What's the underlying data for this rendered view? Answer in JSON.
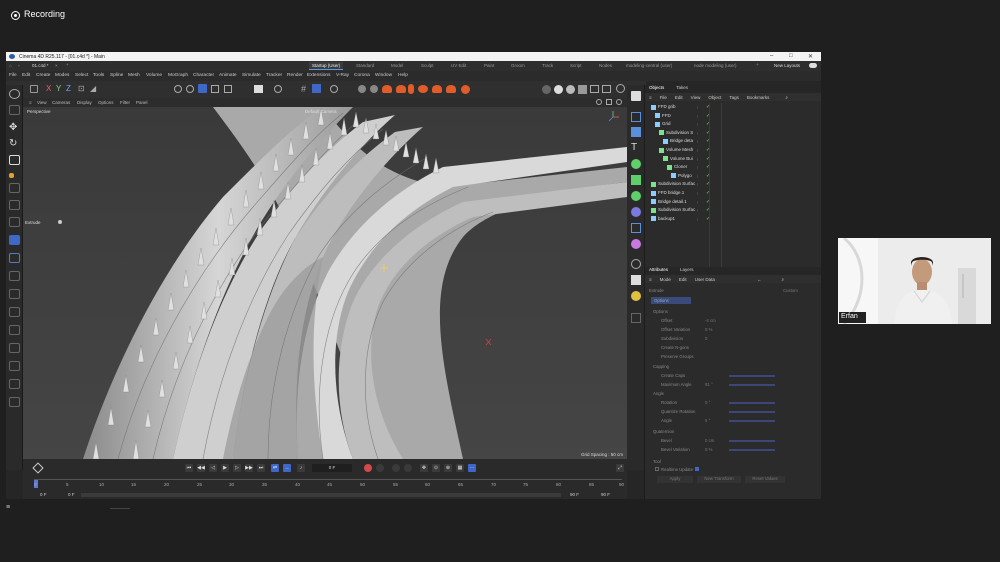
{
  "meeting": {
    "recording_label": "Recording",
    "participant_name": "Erfan"
  },
  "window": {
    "title": "Cinema 4D R25.117 - [01.c4d *] - Main",
    "minimize": "–",
    "maximize": "□",
    "close": "✕"
  },
  "tabs": {
    "file_tab": "01.c4d *",
    "layouts": [
      "Startup (User)",
      "Standard",
      "Model",
      "Sculpt",
      "UV Edit",
      "Paint",
      "Groom",
      "Track",
      "Script",
      "Nodes",
      "modeling-central (user)",
      "node modeling (user)"
    ],
    "new_layouts": "New Layouts"
  },
  "menu": [
    "File",
    "Edit",
    "Create",
    "Modes",
    "Select",
    "Tools",
    "Spline",
    "Mesh",
    "Volume",
    "MoGraph",
    "Character",
    "Animate",
    "Simulate",
    "Tracker",
    "Render",
    "Extensions",
    "V-Ray",
    "Corona",
    "Window",
    "Help"
  ],
  "viewport_menu": [
    "View",
    "Cameras",
    "Display",
    "Options",
    "Filter",
    "Panel"
  ],
  "viewport": {
    "view_name": "Perspective",
    "camera": "Default Camera",
    "grid_spacing": "Grid Spacing : 50 cm",
    "hud_tool": "Extrude"
  },
  "timeline": {
    "ticks": [
      "0",
      "5",
      "10",
      "15",
      "20",
      "25",
      "30",
      "35",
      "40",
      "45",
      "50",
      "55",
      "60",
      "65",
      "70",
      "75",
      "80",
      "85",
      "90"
    ],
    "start": "0 F",
    "preview_start": "0 F",
    "current": "0 F",
    "end": "90 F",
    "preview_end": "90 F"
  },
  "objects_panel": {
    "tabs": [
      "Objects",
      "Takes"
    ],
    "menu": [
      "File",
      "Edit",
      "View",
      "Object",
      "Tags",
      "Bookmarks"
    ],
    "items": [
      {
        "name": "FFD grib",
        "depth": 0,
        "color": "#8ecbff"
      },
      {
        "name": "FFD",
        "depth": 1,
        "color": "#8ecbff"
      },
      {
        "name": "Grid",
        "depth": 1,
        "color": "#8ecbff"
      },
      {
        "name": "Subdivision S",
        "depth": 2,
        "color": "#7fe08a"
      },
      {
        "name": "Bridge deta",
        "depth": 3,
        "color": "#8ecbff"
      },
      {
        "name": "Volume Mesh",
        "depth": 2,
        "color": "#7fe08a"
      },
      {
        "name": "Volume Bui",
        "depth": 3,
        "color": "#7fe08a"
      },
      {
        "name": "Cloner",
        "depth": 4,
        "color": "#7fe08a"
      },
      {
        "name": "Polygo",
        "depth": 5,
        "color": "#8ecbff"
      },
      {
        "name": "Subdivision Surfac",
        "depth": 0,
        "color": "#7fe08a"
      },
      {
        "name": "FFD bridge.1",
        "depth": 0,
        "color": "#8ecbff"
      },
      {
        "name": "Bridge detail.1",
        "depth": 0,
        "color": "#8ecbff"
      },
      {
        "name": "Subdivision Surfac",
        "depth": 0,
        "color": "#7fe08a"
      },
      {
        "name": "backup1",
        "depth": 0,
        "color": "#8ecbff"
      }
    ]
  },
  "attributes_panel": {
    "tabs": [
      "Attributes",
      "Layers"
    ],
    "menu": [
      "Mode",
      "Edit",
      "User Data"
    ],
    "tool_name": "Extrude",
    "dropdown": "Custom",
    "tab": "Options",
    "sections": {
      "options": "Options",
      "caps": "Capping",
      "angle": "Angle",
      "quat": "Quaternion",
      "tool": "Tool"
    },
    "rows": [
      {
        "label": "Offset",
        "value": "-4 cm",
        "slider": true
      },
      {
        "label": "Offset Variation",
        "value": "0 %",
        "slider": false
      },
      {
        "label": "Subdivision",
        "value": "0",
        "slider": false
      },
      {
        "label": "Create N-gons",
        "value": "",
        "slider": false
      },
      {
        "label": "Preserve Groups",
        "value": "",
        "slider": false
      }
    ],
    "caps_rows": [
      {
        "label": "Create Caps",
        "value": ""
      },
      {
        "label": "Maximum Angle",
        "value": "91 °"
      }
    ],
    "angle_rows": [
      {
        "label": "Rotation",
        "value": "0 °"
      },
      {
        "label": "Quantize Rotation",
        "value": ""
      },
      {
        "label": "Angle",
        "value": "5 °"
      }
    ],
    "quat_rows": [
      {
        "label": "Bevel",
        "value": "0 cm"
      },
      {
        "label": "Bevel Variation",
        "value": "0 %"
      }
    ],
    "realtime_label": "Realtime Update",
    "apply_button": "Apply",
    "new_transform_button": "New Transform",
    "reset_values_button": "Reset Values"
  }
}
